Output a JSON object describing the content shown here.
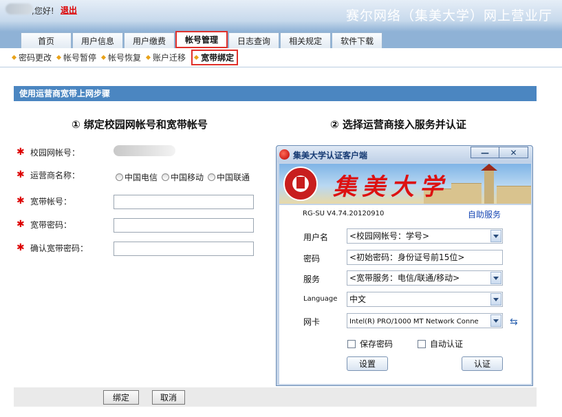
{
  "header": {
    "greeting": ",您好!",
    "logout_label": "退出",
    "site_title": "赛尔网络（集美大学）网上营业厅"
  },
  "main_tabs": [
    {
      "label": "首页"
    },
    {
      "label": "用户信息"
    },
    {
      "label": "用户缴费"
    },
    {
      "label": "帐号管理",
      "active": true
    },
    {
      "label": "日志查询"
    },
    {
      "label": "相关规定"
    },
    {
      "label": "软件下载"
    }
  ],
  "sub_nav": [
    {
      "label": "密码更改"
    },
    {
      "label": "帐号暂停"
    },
    {
      "label": "帐号恢复"
    },
    {
      "label": "账户迁移"
    },
    {
      "label": "宽带绑定",
      "active": true
    }
  ],
  "section": {
    "title": "使用运营商宽带上网步骤",
    "step1": "① 绑定校园网帐号和宽带帐号",
    "step2": "② 选择运营商接入服务并认证"
  },
  "form": {
    "campus_account_label": "校园网帐号：",
    "carrier_label": "运营商名称：",
    "carrier_options": [
      "中国电信",
      "中国移动",
      "中国联通"
    ],
    "broadband_account_label": "宽带帐号：",
    "broadband_password_label": "宽带密码：",
    "confirm_password_label": "确认宽带密码：",
    "bind_button": "绑定",
    "cancel_button": "取消"
  },
  "client": {
    "title": "集美大学认证客户端",
    "minimize_label": "—",
    "close_label": "✕",
    "banner_text": "集美大学",
    "version": "RG-SU V4.74.20120910",
    "self_service": "自助服务",
    "username_label": "用户名",
    "username_value": "<校园网帐号：学号>",
    "password_label": "密码",
    "password_value": "<初始密码：身份证号前15位>",
    "service_label": "服务",
    "service_value": "<宽带服务：电信/联通/移动>",
    "language_label": "Language",
    "language_value": "中文",
    "nic_label": "网卡",
    "nic_value": "Intel(R) PRO/1000 MT Network Conne",
    "save_password_label": "保存密码",
    "auto_auth_label": "自动认证",
    "settings_button": "设置",
    "auth_button": "认证"
  },
  "colors": {
    "accent_red": "#e0302a",
    "section_blue": "#4b86c1",
    "header_blue": "#8fb2d6"
  }
}
